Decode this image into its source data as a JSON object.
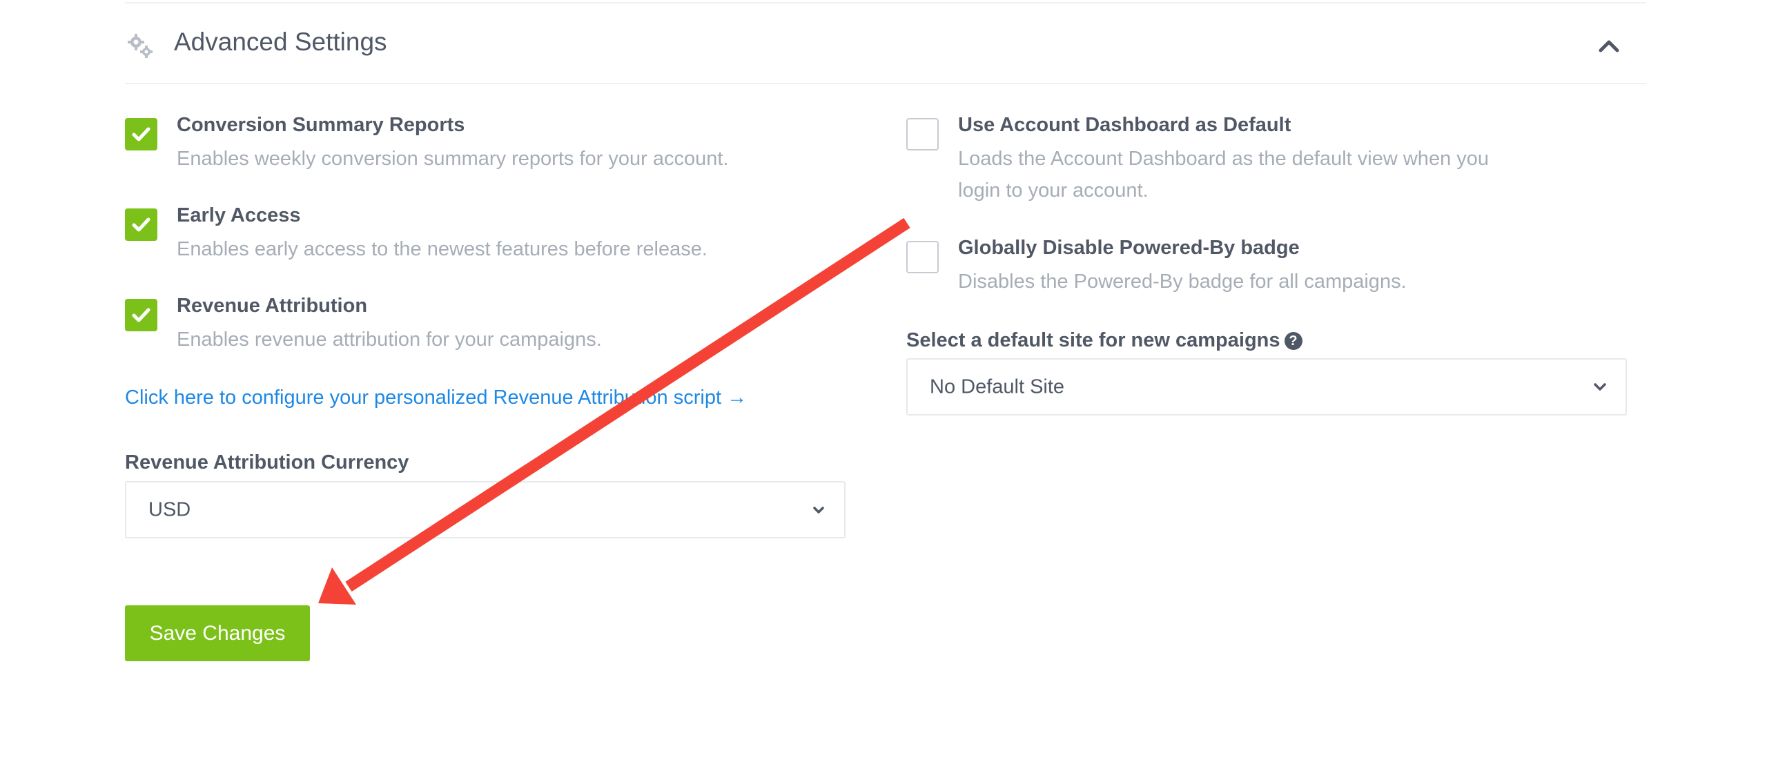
{
  "header": {
    "title": "Advanced Settings",
    "icon": "gears-icon",
    "toggle_icon": "chevron-up-icon"
  },
  "left_options": [
    {
      "title": "Conversion Summary Reports",
      "description": "Enables weekly conversion summary reports for your account.",
      "checked": true
    },
    {
      "title": "Early Access",
      "description": "Enables early access to the newest features before release.",
      "checked": true
    },
    {
      "title": "Revenue Attribution",
      "description": "Enables revenue attribution for your campaigns.",
      "checked": true
    }
  ],
  "right_options": [
    {
      "title": "Use Account Dashboard as Default",
      "description_line1": "Loads the Account Dashboard as the default view when you",
      "description_line2": "login to your account.",
      "checked": false
    },
    {
      "title": "Globally Disable Powered-By badge",
      "description": "Disables the Powered-By badge for all campaigns.",
      "checked": false
    }
  ],
  "revenue_link": "Click here to configure your personalized Revenue Attribution script →",
  "currency": {
    "label": "Revenue Attribution Currency",
    "value": "USD"
  },
  "default_site": {
    "label": "Select a default site for new campaigns",
    "help_glyph": "?",
    "value": "No Default Site"
  },
  "save_button": "Save Changes",
  "colors": {
    "accent_green": "#7cc11a",
    "link_blue": "#1e88e5",
    "annotation_red": "#f44336",
    "text_dark": "#505866",
    "text_muted": "#a6adb6"
  }
}
